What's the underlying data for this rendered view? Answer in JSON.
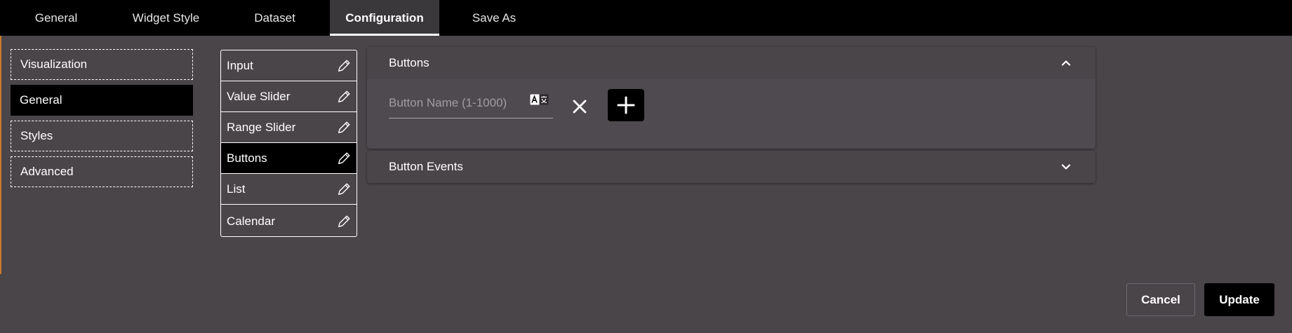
{
  "tabs": [
    {
      "label": "General"
    },
    {
      "label": "Widget Style"
    },
    {
      "label": "Dataset"
    },
    {
      "label": "Configuration",
      "active": true
    },
    {
      "label": "Save As"
    }
  ],
  "sidebar": {
    "items": [
      {
        "label": "Visualization"
      },
      {
        "label": "General",
        "active": true
      },
      {
        "label": "Styles"
      },
      {
        "label": "Advanced"
      }
    ]
  },
  "components": {
    "items": [
      {
        "label": "Input",
        "icon": "pencil-icon"
      },
      {
        "label": "Value Slider",
        "icon": "pencil-icon"
      },
      {
        "label": "Range Slider",
        "icon": "pencil-icon"
      },
      {
        "label": "Buttons",
        "icon": "pencil-icon",
        "active": true
      },
      {
        "label": "List",
        "icon": "pencil-icon"
      },
      {
        "label": "Calendar",
        "icon": "pencil-icon"
      }
    ]
  },
  "buttons_panel": {
    "title": "Buttons",
    "expanded": true,
    "name_field": {
      "placeholder": "Button Name (1-1000)",
      "value": ""
    },
    "translate_icon": "translate-icon",
    "remove_icon": "close-icon",
    "add_icon": "plus-icon"
  },
  "button_events_panel": {
    "title": "Button Events",
    "expanded": false
  },
  "footer": {
    "cancel_label": "Cancel",
    "update_label": "Update"
  },
  "colors": {
    "background": "#4a4549",
    "tabbar": "#000000",
    "active": "#000000",
    "accent_edge": "#c77b2a"
  }
}
